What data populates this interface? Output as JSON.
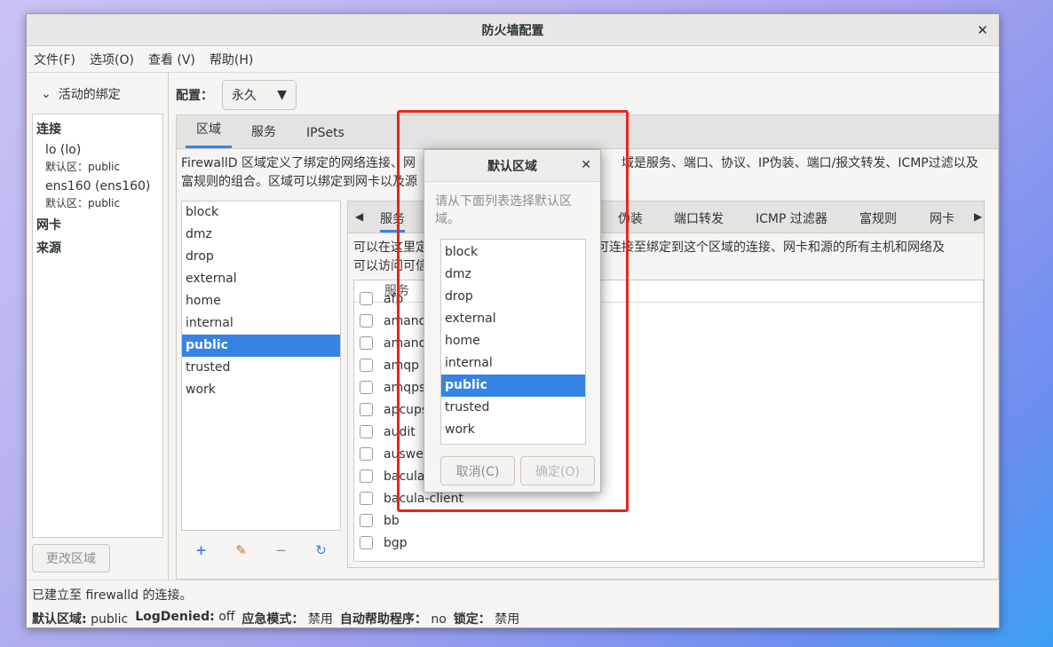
{
  "window": {
    "title": "防火墙配置"
  },
  "menu": [
    "文件(F)",
    "选项(O)",
    "查看 (V)",
    "帮助(H)"
  ],
  "bindings": {
    "header": "活动的绑定",
    "connections_label": "连接",
    "connections": [
      {
        "name": "lo (lo)",
        "zone": "默认区：public"
      },
      {
        "name": "ens160 (ens160)",
        "zone": "默认区：public"
      }
    ],
    "nic_label": "网卡",
    "source_label": "来源",
    "change_zone_button": "更改区域"
  },
  "config": {
    "label": "配置：",
    "value": "永久"
  },
  "main_tabs": [
    "区域",
    "服务",
    "IPSets"
  ],
  "zones_description_line1": "FirewallD 区域定义了绑定的网络连接、网",
  "zones_description_line1b": "域是服务、端口、协议、IP伪装、端口/报文转发、ICMP过滤以及",
  "zones_description_line2": "富规则的组合。区域可以绑定到网卡以及源",
  "zones": [
    "block",
    "dmz",
    "drop",
    "external",
    "home",
    "internal",
    "public",
    "trusted",
    "work"
  ],
  "selected_zone": "public",
  "zone_tools": {
    "add_icon": "+",
    "edit_icon": "✎",
    "remove_icon": "−",
    "reload_icon": "↻"
  },
  "zone_tabs": [
    "服务",
    "伪装",
    "端口转发",
    "ICMP 过滤器",
    "富规则",
    "网卡"
  ],
  "services_description_line1": "可以在这里定",
  "services_description_line1b": "可连接至绑定到这个区域的连接、网卡和源的所有主机和网络及",
  "services_description_line2": "可以访问可信",
  "services_column": "服务",
  "services": [
    "afp",
    "amanda",
    "amanda",
    "amqp",
    "amqps",
    "apcups",
    "audit",
    "ausweis",
    "bacula",
    "bacula-client",
    "bb",
    "bgp"
  ],
  "status": {
    "connection": "已建立至 firewalld 的连接。",
    "default_zone_label": "默认区域:",
    "default_zone_value": "public",
    "log_denied_label": "LogDenied:",
    "log_denied_value": "off",
    "panic_label": "应急模式：",
    "panic_value": "禁用",
    "helper_label": "自动帮助程序：",
    "helper_value": "no",
    "lock_label": "锁定：",
    "lock_value": "禁用"
  },
  "dialog": {
    "title": "默认区域",
    "hint": "请从下面列表选择默认区域。",
    "zones": [
      "block",
      "dmz",
      "drop",
      "external",
      "home",
      "internal",
      "public",
      "trusted",
      "work"
    ],
    "selected": "public",
    "cancel_button": "取消(C)",
    "ok_button": "确定(O)"
  },
  "colors": {
    "accent": "#3584e4",
    "highlight_box": "#e8251f"
  }
}
